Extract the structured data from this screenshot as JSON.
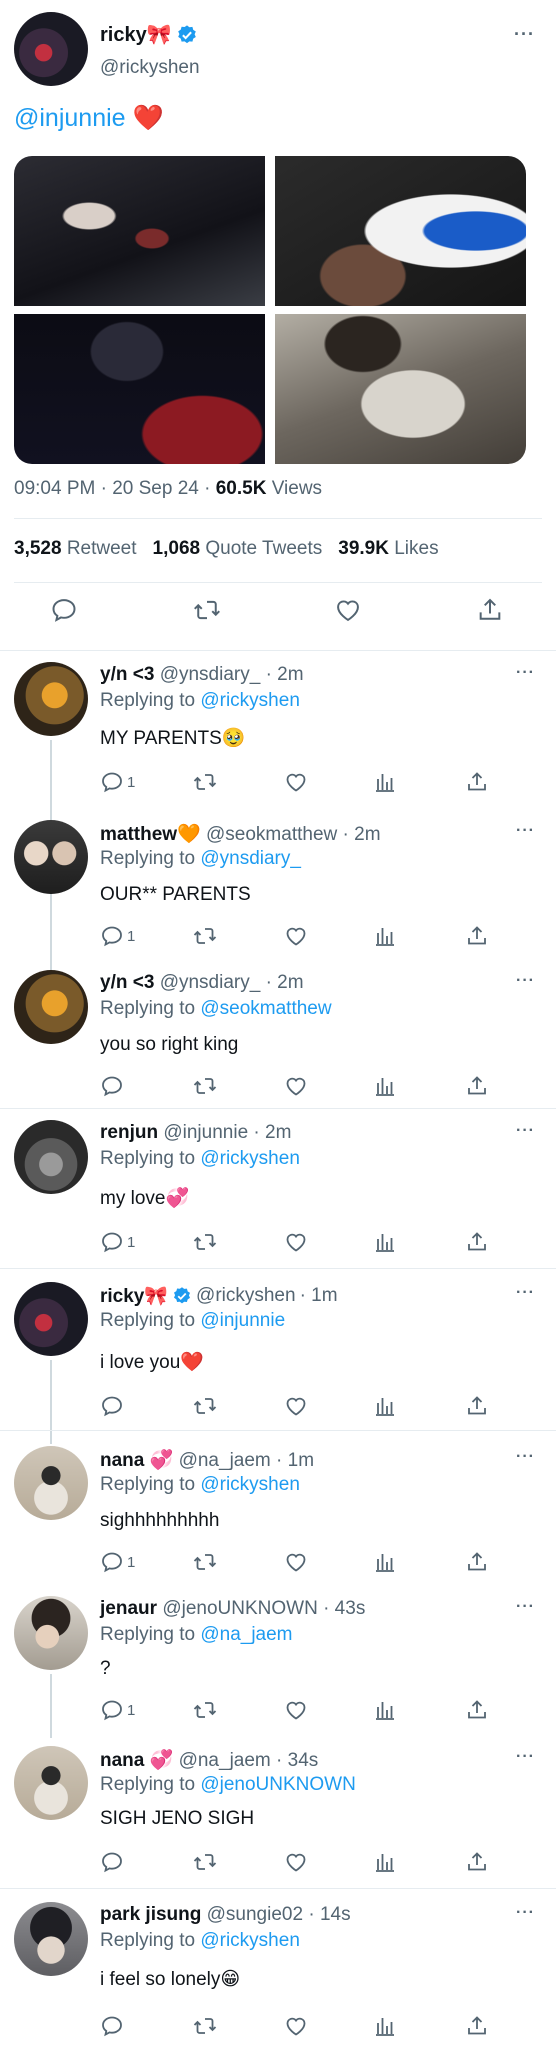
{
  "main": {
    "name": "ricky🎀",
    "handle": "@rickyshen",
    "more": "···",
    "text_mention": "@injunnie",
    "text_emoji": "❤️",
    "time": "09:04 PM · 20 Sep 24 · ",
    "views_count": "60.5K",
    "views_label": " Views",
    "retweets": "3,528",
    "retweets_label": "Retweet",
    "quotes": "1,068",
    "quotes_label": "Quote Tweets",
    "likes": "39.9K",
    "likes_label": "Likes"
  },
  "colors": {
    "accent": "#1d9bf0",
    "secondary": "#536471",
    "text": "#0f1419",
    "border": "#e6ecf0"
  },
  "replies": [
    {
      "name": "y/n <3",
      "handle": "@ynsdiary_",
      "time": "· 2m",
      "replying_label": "Replying to",
      "replying_to": "@rickyshen",
      "text": "MY PARENTS🥹",
      "reply_count": "1"
    },
    {
      "name": "matthew🧡",
      "handle": "@seokmatthew",
      "time": "· 2m",
      "replying_label": "Replying to",
      "replying_to": "@ynsdiary_",
      "text": "OUR** PARENTS",
      "reply_count": "1"
    },
    {
      "name": "y/n <3",
      "handle": "@ynsdiary_",
      "time": "· 2m",
      "replying_label": "Replying to",
      "replying_to": "@seokmatthew",
      "text": "you so right king",
      "reply_count": ""
    },
    {
      "name": "renjun",
      "handle": "@injunnie",
      "time": "· 2m",
      "replying_label": "Replying to",
      "replying_to": "@rickyshen",
      "text": "my love💞",
      "reply_count": "1"
    },
    {
      "name": "ricky🎀",
      "handle": "@rickyshen",
      "time": "· 1m",
      "replying_label": "Replying to",
      "replying_to": "@injunnie",
      "text": "i love you❤️",
      "reply_count": ""
    },
    {
      "name": "nana 💞",
      "handle": "@na_jaem",
      "time": "· 1m",
      "replying_label": "Replying to",
      "replying_to": "@rickyshen",
      "text": "sighhhhhhhhh",
      "reply_count": "1"
    },
    {
      "name": "jenaur",
      "handle": "@jenoUNKNOWN",
      "time": "· 43s",
      "replying_label": "Replying to",
      "replying_to": "@na_jaem",
      "text": "?",
      "reply_count": "1"
    },
    {
      "name": "nana 💞",
      "handle": "@na_jaem",
      "time": "· 34s",
      "replying_label": "Replying to",
      "replying_to": "@jenoUNKNOWN",
      "text": "SIGH JENO SIGH",
      "reply_count": ""
    },
    {
      "name": "park jisung",
      "handle": "@sungie02",
      "time": "· 14s",
      "replying_label": "Replying to",
      "replying_to": "@rickyshen",
      "text": "i feel so lonely😁",
      "reply_count": ""
    }
  ]
}
